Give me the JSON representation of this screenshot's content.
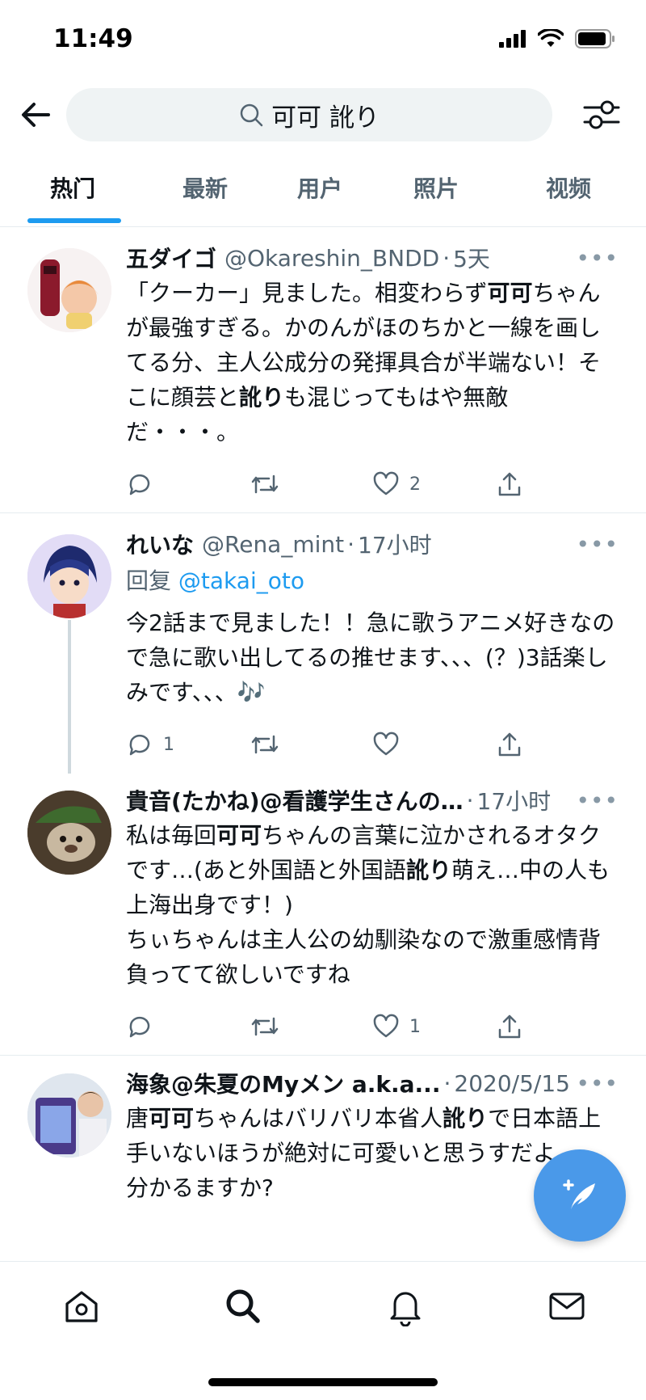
{
  "status_bar": {
    "time": "11:49"
  },
  "search": {
    "query": "可可 訛り"
  },
  "tabs": [
    {
      "label": "热门",
      "active": true
    },
    {
      "label": "最新",
      "active": false
    },
    {
      "label": "用户",
      "active": false
    },
    {
      "label": "照片",
      "active": false
    },
    {
      "label": "视频",
      "active": false
    }
  ],
  "tweets": [
    {
      "author": "五ダイゴ",
      "handle": "@Okareshin_BNDD",
      "time": "5天",
      "body_html": "「クーカー」見ました。相変わらず<b>可可</b>ちゃんが最強すぎる。かのんがほのちかと一線を画してる分、主人公成分の発揮具合が半端ない！そこに顔芸と<b>訛り</b>も混じってもはや無敵だ・・・。",
      "replies": "",
      "retweets": "",
      "likes": "2"
    },
    {
      "author": "れいな",
      "handle": "@Rena_mint",
      "time": "17小时",
      "reply_prefix": "回复",
      "reply_to": "@takai_oto",
      "body_html": "今2話まで見ました！！急に歌うアニメ好きなので急に歌い出してるの推せます、、、(？)3話楽しみです、、、🎶",
      "replies": "1",
      "retweets": "",
      "likes": ""
    },
    {
      "author": "貴音(たかね)@看護学生さんの…",
      "handle": "",
      "time": "17小时",
      "body_html": "私は毎回<b>可可</b>ちゃんの言葉に泣かされるオタクです…(あと外国語と外国語<b>訛り</b>萌え…中の人も上海出身です！)<br>ちぃちゃんは主人公の幼馴染なので激重感情背負ってて欲しいですね",
      "replies": "",
      "retweets": "",
      "likes": "1"
    },
    {
      "author": "海象@朱夏のMyメン a.k.a...",
      "handle": "",
      "time": "2020/5/15",
      "body_html": "唐<b>可可</b>ちゃんはバリバリ本省人<b>訛り</b>で日本語上手いないほうが絶対に可愛いと思うすだよ<br>分かるますか?",
      "replies": "",
      "retweets": "",
      "likes": ""
    }
  ],
  "accent_color": "#1d9bf0",
  "bottom_nav": [
    "home-icon",
    "search-icon",
    "bell-icon",
    "mail-icon"
  ]
}
